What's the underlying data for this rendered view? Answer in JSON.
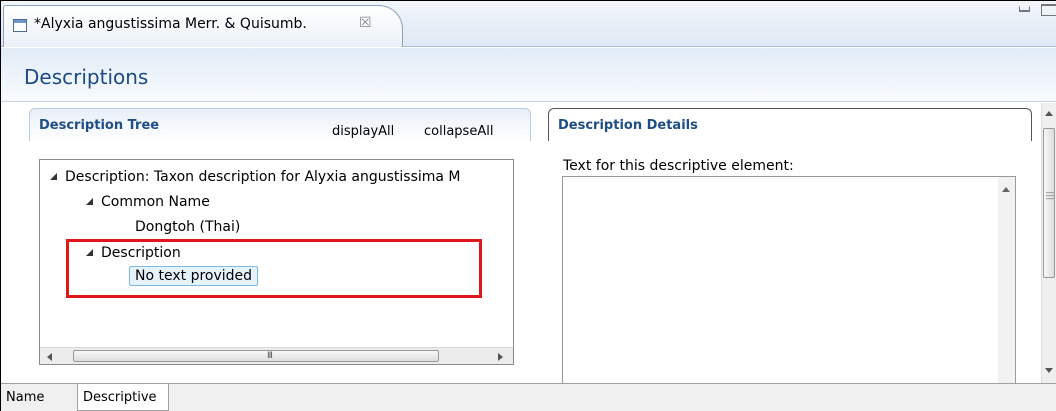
{
  "editor": {
    "tab_title": "*Alyxia angustissima Merr. & Quisumb.",
    "tab_close": "☒",
    "form_title": "Descriptions"
  },
  "tree_section": {
    "title": "Description Tree",
    "display_all": "displayAll",
    "collapse_all": "collapseAll",
    "nodes": [
      {
        "level": 0,
        "expanded": true,
        "label": "Description: Taxon description for Alyxia angustissima M"
      },
      {
        "level": 1,
        "expanded": true,
        "label": "Common Name"
      },
      {
        "level": 2,
        "expanded": false,
        "label": "Dongtoh (Thai)"
      },
      {
        "level": 1,
        "expanded": true,
        "label": "Description"
      },
      {
        "level": 2,
        "expanded": false,
        "label": "No text provided",
        "selected": true
      }
    ],
    "scroll_grip": "III"
  },
  "details_section": {
    "title": "Description Details",
    "text_label": "Text for this descriptive element:",
    "text_value": ""
  },
  "page_tabs": [
    {
      "label": "Name",
      "active": false
    },
    {
      "label": "Descriptive",
      "active": true
    }
  ],
  "colors": {
    "form_title": "#1b4a84",
    "section_title": "#1f4d85",
    "highlight_box": "#e0161b",
    "selection_border": "#7fbbe6"
  }
}
